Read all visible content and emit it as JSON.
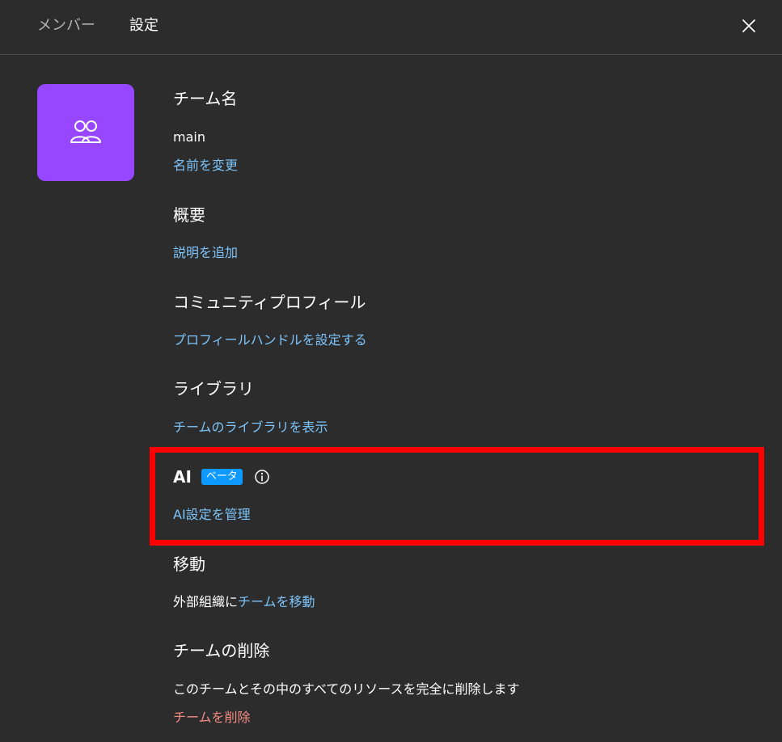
{
  "header": {
    "tabs": [
      {
        "label": "メンバー"
      },
      {
        "label": "設定"
      }
    ],
    "close_icon": "close-icon"
  },
  "avatar": {
    "icon": "team-users-icon",
    "color": "#9747ff"
  },
  "sections": {
    "team_name": {
      "title": "チーム名",
      "value": "main",
      "action": "名前を変更"
    },
    "overview": {
      "title": "概要",
      "action": "説明を追加"
    },
    "community_profile": {
      "title": "コミュニティプロフィール",
      "action": "プロフィールハンドルを設定する"
    },
    "library": {
      "title": "ライブラリ",
      "action": "チームのライブラリを表示"
    },
    "ai": {
      "title": "AI",
      "badge": "ベータ",
      "info_icon": "info-icon",
      "action": "AI設定を管理"
    },
    "move": {
      "title": "移動",
      "text_prefix": "外部組織に",
      "action": "チームを移動"
    },
    "delete": {
      "title": "チームの削除",
      "description": "このチームとその中のすべてのリソースを完全に削除します",
      "action": "チームを削除"
    }
  },
  "colors": {
    "background": "#2c2c2c",
    "link": "#7cc4fa",
    "danger": "#f28b82",
    "badge": "#0d99ff",
    "highlight": "#ff0000"
  }
}
